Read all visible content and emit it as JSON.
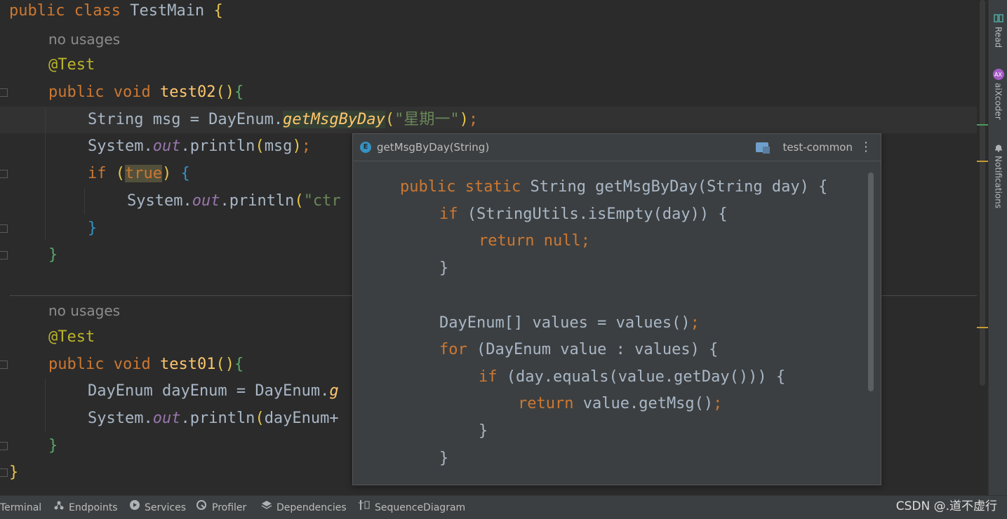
{
  "editor": {
    "line1": {
      "kw1": "public",
      "kw2": "class",
      "name": "TestMain",
      "brace": "{"
    },
    "hint1": "no usages",
    "ann1": "@Test",
    "line4": {
      "kw1": "public",
      "kw2": "void",
      "fn": "test02",
      "parens": "()",
      "brace": "{"
    },
    "line5": {
      "pre": "String msg = DayEnum.",
      "call": "getMsgByDay",
      "p1": "(",
      "arg": "\"星期一\"",
      "p2": ")",
      "semi": ";"
    },
    "line6": {
      "pre": "System.",
      "field": "out",
      "post": ".println",
      "p1": "(",
      "arg": "msg",
      "p2": ")",
      "semi": ";"
    },
    "line7": {
      "kw": "if",
      "p1": "(",
      "val": "true",
      "p2": ")",
      "brace": "{"
    },
    "line8": {
      "pre": "System.",
      "field": "out",
      "post": ".println",
      "p1": "(",
      "arg": "\"ctr"
    },
    "line9": {
      "brace": "}"
    },
    "line10": {
      "brace": "}"
    },
    "hint2": "no usages",
    "ann2": "@Test",
    "line13": {
      "kw1": "public",
      "kw2": "void",
      "fn": "test01",
      "parens": "()",
      "brace": "{"
    },
    "line14": {
      "pre": "DayEnum dayEnum = DayEnum.",
      "call": "g"
    },
    "line15": {
      "pre": "System.",
      "field": "out",
      "post": ".println",
      "p1": "(",
      "arg": "dayEnum+"
    },
    "line16": {
      "brace": "}"
    },
    "line17": {
      "brace": "}"
    }
  },
  "popup": {
    "icon_letter": "E",
    "title": "getMsgByDay(String)",
    "module": "test-common",
    "menu": "⋮",
    "code": {
      "l1": {
        "kw1": "public",
        "kw2": "static",
        "rest": "String getMsgByDay(String day) {"
      },
      "l2": {
        "kw": "if",
        "rest": "(StringUtils.isEmpty(day)) {"
      },
      "l3": {
        "kw": "return",
        "val": "null",
        "semi": ";"
      },
      "l4": {
        "rest": "}"
      },
      "l6": {
        "rest": "DayEnum[] values = values()",
        "semi": ";"
      },
      "l7": {
        "kw": "for",
        "rest": "(DayEnum value : values) {"
      },
      "l8": {
        "kw": "if",
        "rest": "(day.equals(value.getDay())) {"
      },
      "l9": {
        "kw": "return",
        "rest": "value.getMsg()",
        "semi": ";"
      },
      "l10": {
        "rest": "}"
      },
      "l11": {
        "rest": "}"
      }
    }
  },
  "right_toolbar": {
    "read": "Read",
    "aixcoder": "aiXcoder",
    "notifications": "Notifications",
    "aix_icon": "AX"
  },
  "statusbar": {
    "terminal": "Terminal",
    "endpoints": "Endpoints",
    "services": "Services",
    "profiler": "Profiler",
    "dependencies": "Dependencies",
    "sequence": "SequenceDiagram",
    "watermark": "CSDN @.道不虚行"
  },
  "colors": {
    "keyword": "#cc7832",
    "annotation": "#bbb529",
    "method": "#ffc66d",
    "string": "#6a8759",
    "field": "#9876aa",
    "text": "#a9b7c6",
    "background": "#2b2b2b",
    "popup_bg": "#3c3f41"
  }
}
